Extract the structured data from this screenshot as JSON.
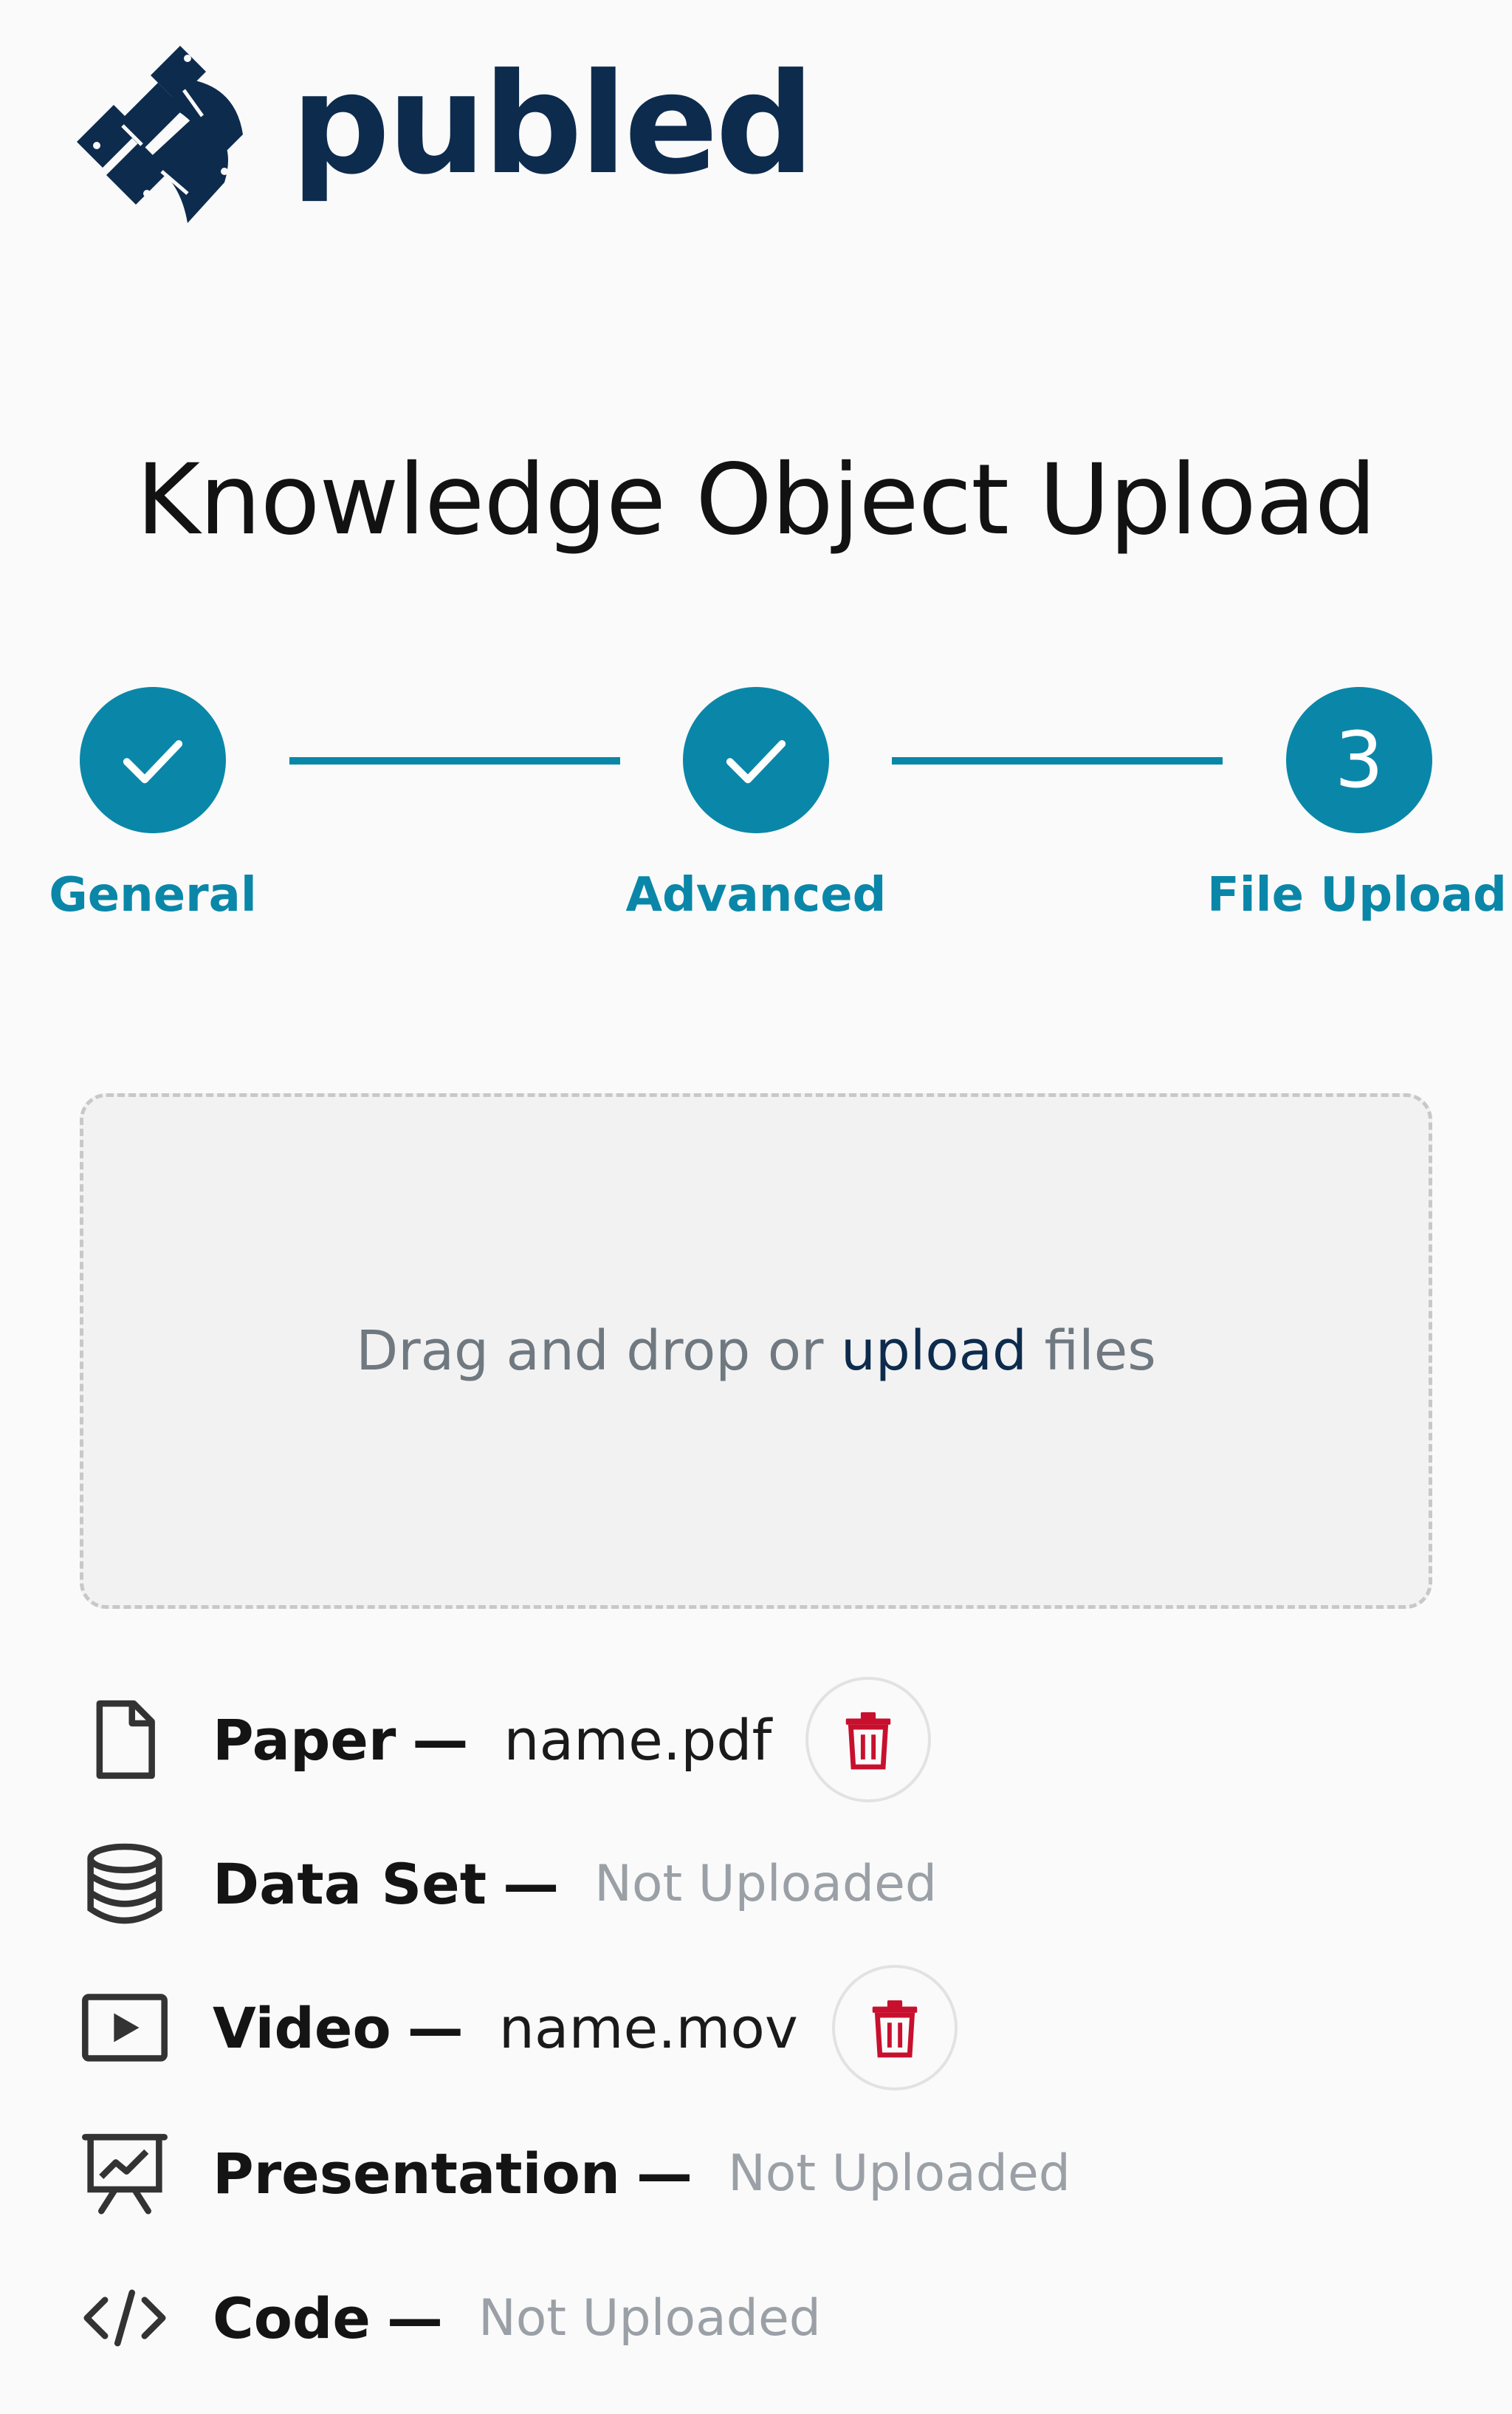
{
  "brand": {
    "name": "publed",
    "color": "#0d2b4d"
  },
  "page": {
    "title": "Knowledge Object Upload"
  },
  "accent_color": "#0a87a8",
  "stepper": {
    "steps": [
      {
        "label": "General",
        "state": "complete"
      },
      {
        "label": "Advanced",
        "state": "complete"
      },
      {
        "label": "File Upload",
        "state": "current",
        "number": "3"
      }
    ]
  },
  "dropzone": {
    "prefix": "Drag and drop or ",
    "link": "upload",
    "suffix": " files"
  },
  "files": [
    {
      "icon": "document-icon",
      "label": "Paper",
      "dash": "—",
      "value": "name.pdf",
      "uploaded": true
    },
    {
      "icon": "database-icon",
      "label": "Data Set",
      "dash": "—",
      "value": "Not Uploaded",
      "uploaded": false
    },
    {
      "icon": "video-icon",
      "label": "Video",
      "dash": "—",
      "value": "name.mov",
      "uploaded": true
    },
    {
      "icon": "presentation-icon",
      "label": "Presentation",
      "dash": "—",
      "value": "Not Uploaded",
      "uploaded": false
    },
    {
      "icon": "code-icon",
      "label": "Code",
      "dash": "—",
      "value": "Not Uploaded",
      "uploaded": false
    }
  ],
  "delete_color": "#c8102e"
}
